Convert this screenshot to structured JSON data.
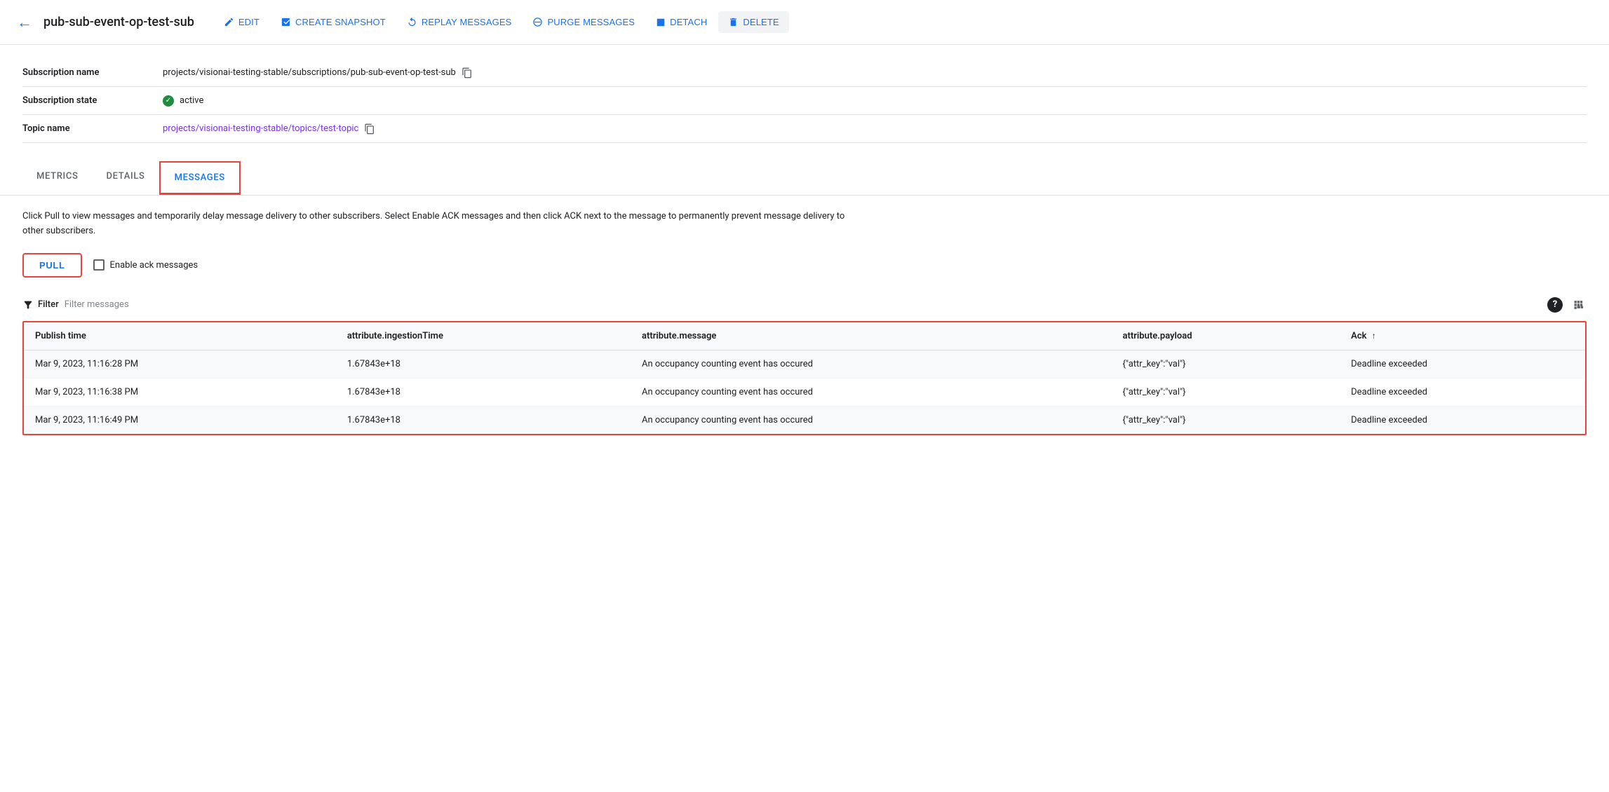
{
  "toolbar": {
    "back_icon": "←",
    "title": "pub-sub-event-op-test-sub",
    "buttons": [
      {
        "id": "edit",
        "label": "EDIT",
        "icon": "✏️"
      },
      {
        "id": "create-snapshot",
        "label": "CREATE SNAPSHOT",
        "icon": "📷"
      },
      {
        "id": "replay-messages",
        "label": "REPLAY MESSAGES",
        "icon": "🕐"
      },
      {
        "id": "purge-messages",
        "label": "PURGE MESSAGES",
        "icon": "⊘"
      },
      {
        "id": "detach",
        "label": "DETACH",
        "icon": "▪"
      },
      {
        "id": "delete",
        "label": "DELETE",
        "icon": "🗑"
      }
    ]
  },
  "info": {
    "rows": [
      {
        "id": "subscription-name",
        "label": "Subscription name",
        "value": "projects/visionai-testing-stable/subscriptions/pub-sub-event-op-test-sub",
        "copyable": true,
        "link": false
      },
      {
        "id": "subscription-state",
        "label": "Subscription state",
        "value": "active",
        "status": "active",
        "copyable": false,
        "link": false
      },
      {
        "id": "topic-name",
        "label": "Topic name",
        "value": "projects/visionai-testing-stable/topics/test-topic",
        "copyable": true,
        "link": true
      }
    ]
  },
  "tabs": [
    {
      "id": "metrics",
      "label": "METRICS",
      "active": false
    },
    {
      "id": "details",
      "label": "DETAILS",
      "active": false
    },
    {
      "id": "messages",
      "label": "MESSAGES",
      "active": true
    }
  ],
  "messages_tab": {
    "description": "Click Pull to view messages and temporarily delay message delivery to other subscribers. Select Enable ACK messages and then click ACK next to the message to permanently prevent message delivery to other subscribers.",
    "pull_label": "PULL",
    "ack_checkbox_label": "Enable ack messages",
    "filter_label": "Filter",
    "filter_placeholder": "Filter messages",
    "help_icon": "?",
    "columns_icon": "|||",
    "table": {
      "headers": [
        {
          "id": "publish-time",
          "label": "Publish time",
          "sortable": false
        },
        {
          "id": "ingestion-time",
          "label": "attribute.ingestionTime",
          "sortable": false
        },
        {
          "id": "message",
          "label": "attribute.message",
          "sortable": false
        },
        {
          "id": "payload",
          "label": "attribute.payload",
          "sortable": false
        },
        {
          "id": "ack",
          "label": "Ack",
          "sortable": true,
          "sort_icon": "↑"
        }
      ],
      "rows": [
        {
          "publish_time": "Mar 9, 2023, 11:16:28 PM",
          "ingestion_time": "1.67843e+18",
          "message": "An occupancy counting event has occured",
          "payload": "{\"attr_key\":\"val\"}",
          "ack": "Deadline exceeded"
        },
        {
          "publish_time": "Mar 9, 2023, 11:16:38 PM",
          "ingestion_time": "1.67843e+18",
          "message": "An occupancy counting event has occured",
          "payload": "{\"attr_key\":\"val\"}",
          "ack": "Deadline exceeded"
        },
        {
          "publish_time": "Mar 9, 2023, 11:16:49 PM",
          "ingestion_time": "1.67843e+18",
          "message": "An occupancy counting event has occured",
          "payload": "{\"attr_key\":\"val\"}",
          "ack": "Deadline exceeded"
        }
      ]
    }
  }
}
